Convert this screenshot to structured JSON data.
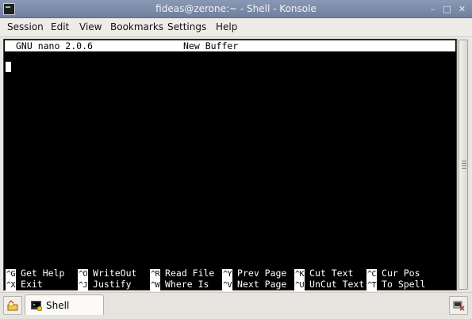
{
  "window": {
    "title": "fideas@zerone:~ - Shell - Konsole",
    "buttons": {
      "minimize": "–",
      "maximize": "□",
      "close": "✕"
    }
  },
  "menubar": [
    "Session",
    "Edit",
    "View",
    "Bookmarks",
    "Settings",
    "Help"
  ],
  "nano": {
    "version": "GNU nano 2.0.6",
    "buffer": "New Buffer",
    "shortcuts_row1": [
      {
        "key": "^G",
        "label": "Get Help"
      },
      {
        "key": "^O",
        "label": "WriteOut"
      },
      {
        "key": "^R",
        "label": "Read File"
      },
      {
        "key": "^Y",
        "label": "Prev Page"
      },
      {
        "key": "^K",
        "label": "Cut Text"
      },
      {
        "key": "^C",
        "label": "Cur Pos"
      }
    ],
    "shortcuts_row2": [
      {
        "key": "^X",
        "label": "Exit"
      },
      {
        "key": "^J",
        "label": "Justify"
      },
      {
        "key": "^W",
        "label": "Where Is"
      },
      {
        "key": "^V",
        "label": "Next Page"
      },
      {
        "key": "^U",
        "label": "UnCut Text"
      },
      {
        "key": "^T",
        "label": "To Spell"
      }
    ]
  },
  "taskbar": {
    "tab_label": "Shell",
    "icons": {
      "new_session": "new-session-icon",
      "shell_tab": "terminal-icon",
      "close_session": "close-session-icon"
    }
  }
}
